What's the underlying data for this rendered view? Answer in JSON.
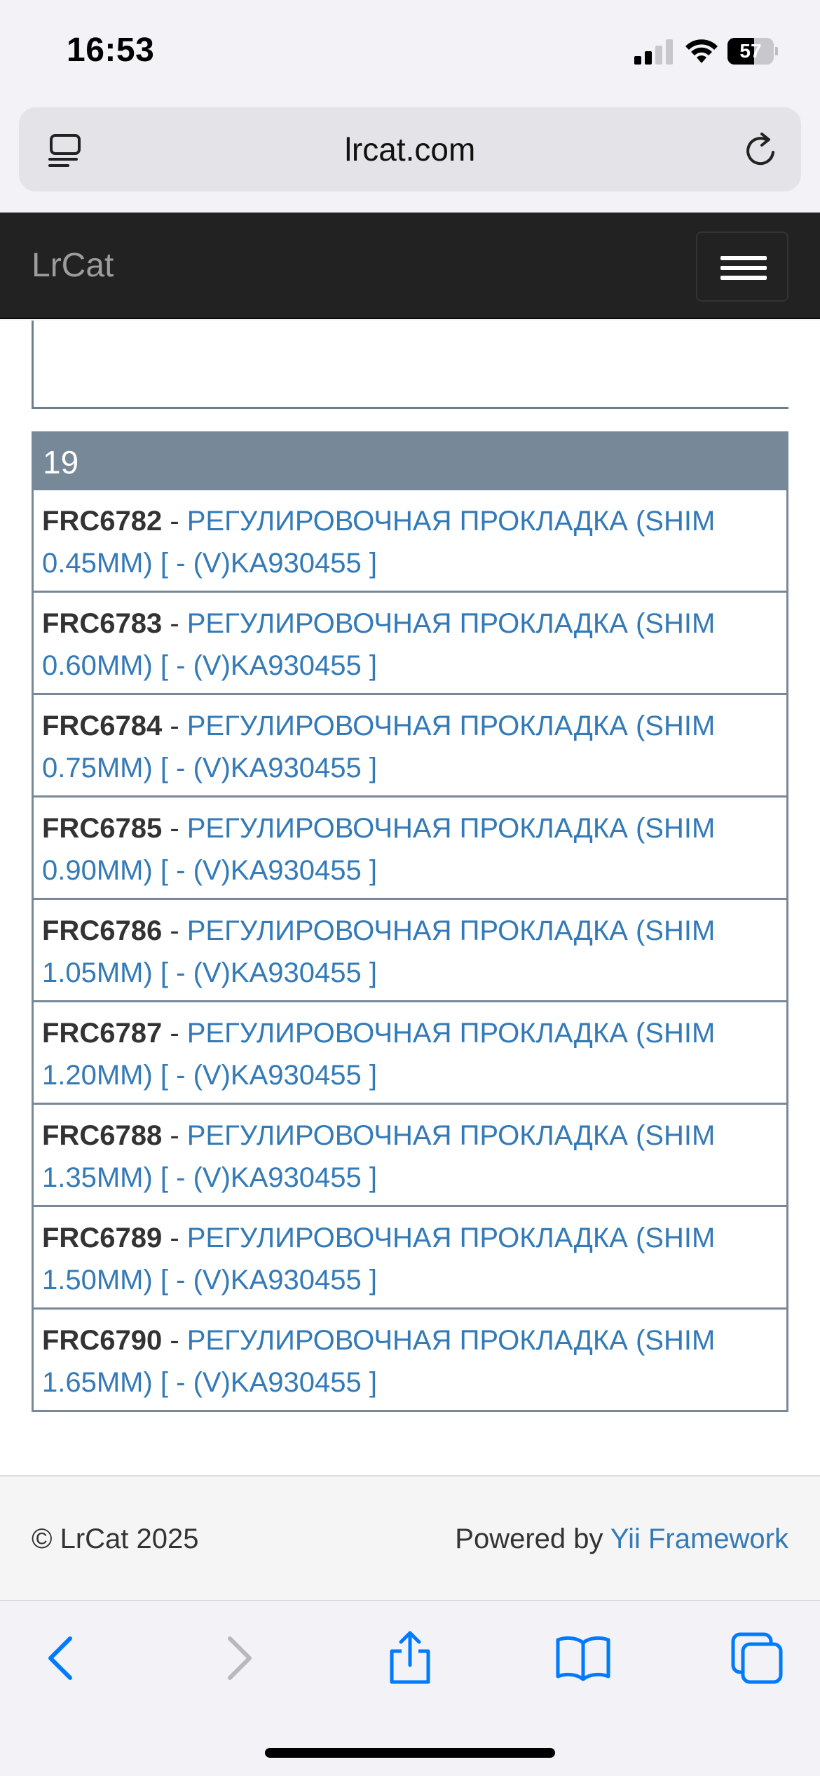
{
  "status_bar": {
    "time": "16:53",
    "battery": "57",
    "battery_level": 0.57
  },
  "browser": {
    "url": "lrcat.com"
  },
  "navbar": {
    "brand": "LrCat"
  },
  "group": {
    "number": "19",
    "items": [
      {
        "code": "FRC6782",
        "sep": " - ",
        "desc": "РЕГУЛИРОВОЧНАЯ ПРОКЛАДКА (SHIM 0.45MM) [ - (V)KA930455 ]"
      },
      {
        "code": "FRC6783",
        "sep": " - ",
        "desc": "РЕГУЛИРОВОЧНАЯ ПРОКЛАДКА (SHIM 0.60MM) [ - (V)KA930455 ]"
      },
      {
        "code": "FRC6784",
        "sep": " - ",
        "desc": "РЕГУЛИРОВОЧНАЯ ПРОКЛАДКА (SHIM 0.75MM) [ - (V)KA930455 ]"
      },
      {
        "code": "FRC6785",
        "sep": " - ",
        "desc": "РЕГУЛИРОВОЧНАЯ ПРОКЛАДКА (SHIM 0.90MM) [ - (V)KA930455 ]"
      },
      {
        "code": "FRC6786",
        "sep": " - ",
        "desc": "РЕГУЛИРОВОЧНАЯ ПРОКЛАДКА (SHIM 1.05MM) [ - (V)KA930455 ]"
      },
      {
        "code": "FRC6787",
        "sep": " - ",
        "desc": "РЕГУЛИРОВОЧНАЯ ПРОКЛАДКА (SHIM 1.20MM) [ - (V)KA930455 ]"
      },
      {
        "code": "FRC6788",
        "sep": " - ",
        "desc": "РЕГУЛИРОВОЧНАЯ ПРОКЛАДКА (SHIM 1.35MM) [ - (V)KA930455 ]"
      },
      {
        "code": "FRC6789",
        "sep": " - ",
        "desc": "РЕГУЛИРОВОЧНАЯ ПРОКЛАДКА (SHIM 1.50MM) [ - (V)KA930455 ]"
      },
      {
        "code": "FRC6790",
        "sep": " - ",
        "desc": "РЕГУЛИРОВОЧНАЯ ПРОКЛАДКА (SHIM 1.65MM) [ - (V)KA930455 ]"
      }
    ]
  },
  "footer": {
    "copyright": "© LrCat 2025",
    "powered_prefix": "Powered by ",
    "powered_link": "Yii Framework"
  },
  "toolbar": {
    "icons": [
      "back-icon",
      "forward-icon",
      "share-icon",
      "bookmarks-icon",
      "tabs-icon"
    ]
  },
  "colors": {
    "link": "#337ab7",
    "navbar": "#222222",
    "group_header": "#778899",
    "ios_blue": "#007aff"
  }
}
